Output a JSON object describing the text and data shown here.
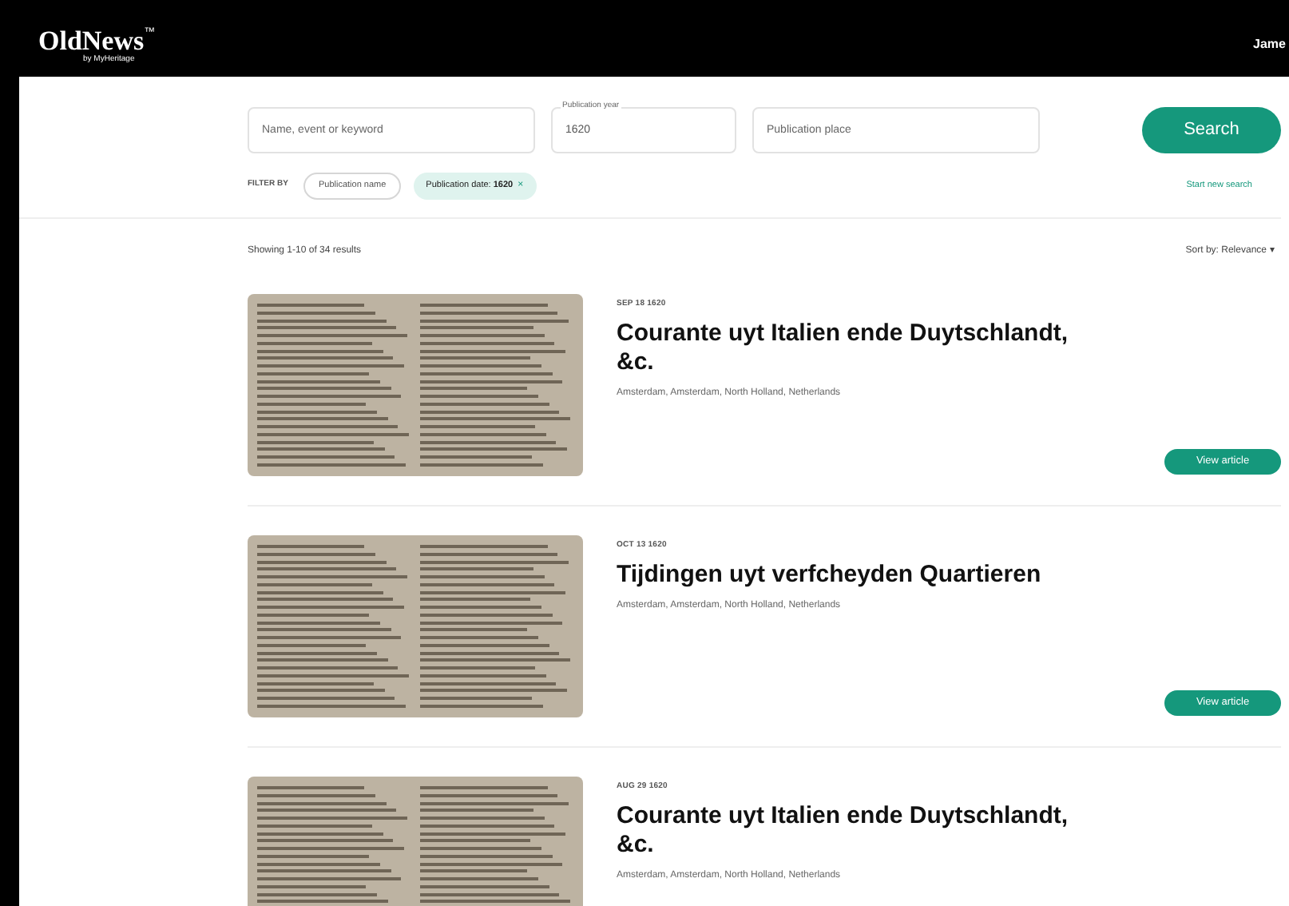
{
  "header": {
    "logo": "OldNews",
    "logo_mark": "™",
    "logo_sub": "by MyHeritage",
    "user": "Jame"
  },
  "search": {
    "keyword": {
      "placeholder": "Name, event or keyword"
    },
    "year": {
      "label": "Publication year",
      "value": "1620"
    },
    "place": {
      "placeholder": "Publication place"
    },
    "button": "Search",
    "reset": "Start new search"
  },
  "filters": {
    "label": "FILTER BY",
    "chips": [
      {
        "text": "Publication name",
        "selected": false
      },
      {
        "text": "Publication date: **1620**",
        "selected": true,
        "remove": "×"
      }
    ]
  },
  "results": {
    "summary": "Showing 1-10 of 34 results",
    "sort": "Sort by: Relevance",
    "sort_caret": "▾"
  },
  "articles": [
    {
      "date": "SEP 18 1620",
      "title": "Courante uyt Italien ende Duytschlandt, &c.",
      "location": "Amsterdam, Amsterdam, North Holland, Netherlands",
      "button": "View article"
    },
    {
      "date": "OCT 13 1620",
      "title": "Tijdingen uyt verfcheyden Quartieren",
      "location": "Amsterdam, Amsterdam, North Holland, Netherlands",
      "button": "View article"
    },
    {
      "date": "AUG 29 1620",
      "title": "Courante uyt Italien ende Duytschlandt, &c.",
      "location": "Amsterdam, Amsterdam, North Holland, Netherlands"
    }
  ]
}
